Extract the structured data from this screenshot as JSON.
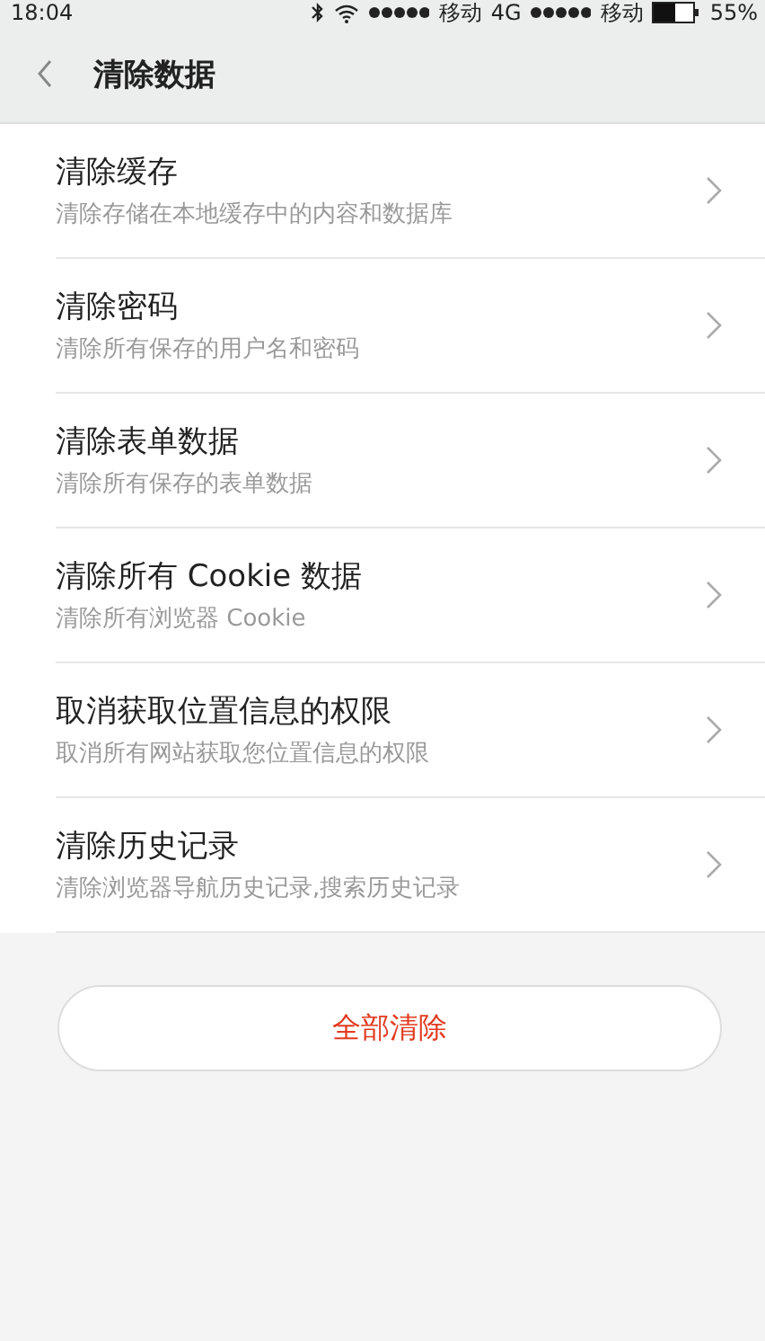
{
  "status_bar": {
    "time": "18:04",
    "carrier_1": "移动",
    "network": "4G",
    "carrier_2": "移动",
    "battery": "55%"
  },
  "header": {
    "title": "清除数据"
  },
  "items": [
    {
      "title": "清除缓存",
      "subtitle": "清除存储在本地缓存中的内容和数据库"
    },
    {
      "title": "清除密码",
      "subtitle": "清除所有保存的用户名和密码"
    },
    {
      "title": "清除表单数据",
      "subtitle": "清除所有保存的表单数据"
    },
    {
      "title": "清除所有 Cookie 数据",
      "subtitle": "清除所有浏览器 Cookie"
    },
    {
      "title": "取消获取位置信息的权限",
      "subtitle": "取消所有网站获取您位置信息的权限"
    },
    {
      "title": "清除历史记录",
      "subtitle": "清除浏览器导航历史记录,搜索历史记录"
    }
  ],
  "clear_all_button": "全部清除"
}
